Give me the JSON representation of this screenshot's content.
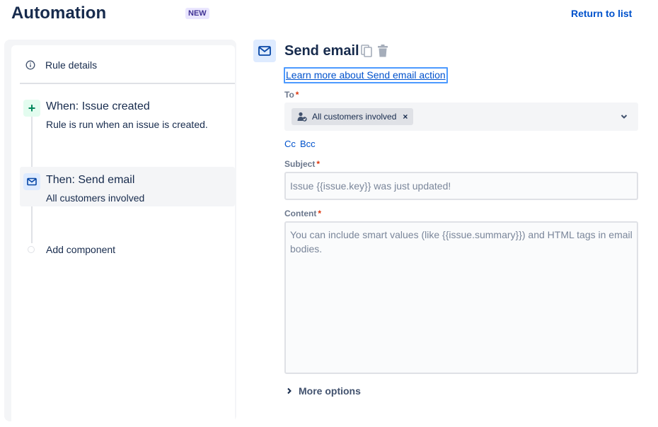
{
  "header": {
    "title": "Automation",
    "badge": "NEW",
    "return_link": "Return to list"
  },
  "sidebar": {
    "rule_details_label": "Rule details",
    "components": [
      {
        "title": "When: Issue created",
        "subtitle": "Rule is run when an issue is created.",
        "icon": "plus-icon"
      },
      {
        "title": "Then: Send email",
        "subtitle": "All customers involved",
        "icon": "mail-icon"
      }
    ],
    "add_component_label": "Add component"
  },
  "action": {
    "title": "Send email",
    "learn_more": "Learn more about Send email action",
    "to": {
      "label": "To",
      "required_mark": "*",
      "selected": "All customers involved"
    },
    "cc_label": "Cc",
    "bcc_label": "Bcc",
    "subject": {
      "label": "Subject",
      "required_mark": "*",
      "value": "",
      "placeholder": "Issue {{issue.key}} was just updated!"
    },
    "content": {
      "label": "Content",
      "required_mark": "*",
      "value": "",
      "placeholder": "You can include smart values (like {{issue.summary}}) and HTML tags in email bodies."
    },
    "more_options_label": "More options"
  },
  "colors": {
    "brand_link": "#0052cc",
    "text": "#172b4d",
    "subtle": "#6b778c",
    "required": "#de350b",
    "new_badge_bg": "#eae6ff",
    "new_badge_text": "#403294",
    "trigger_bg": "#e3fcef",
    "action_bg": "#deebff"
  }
}
